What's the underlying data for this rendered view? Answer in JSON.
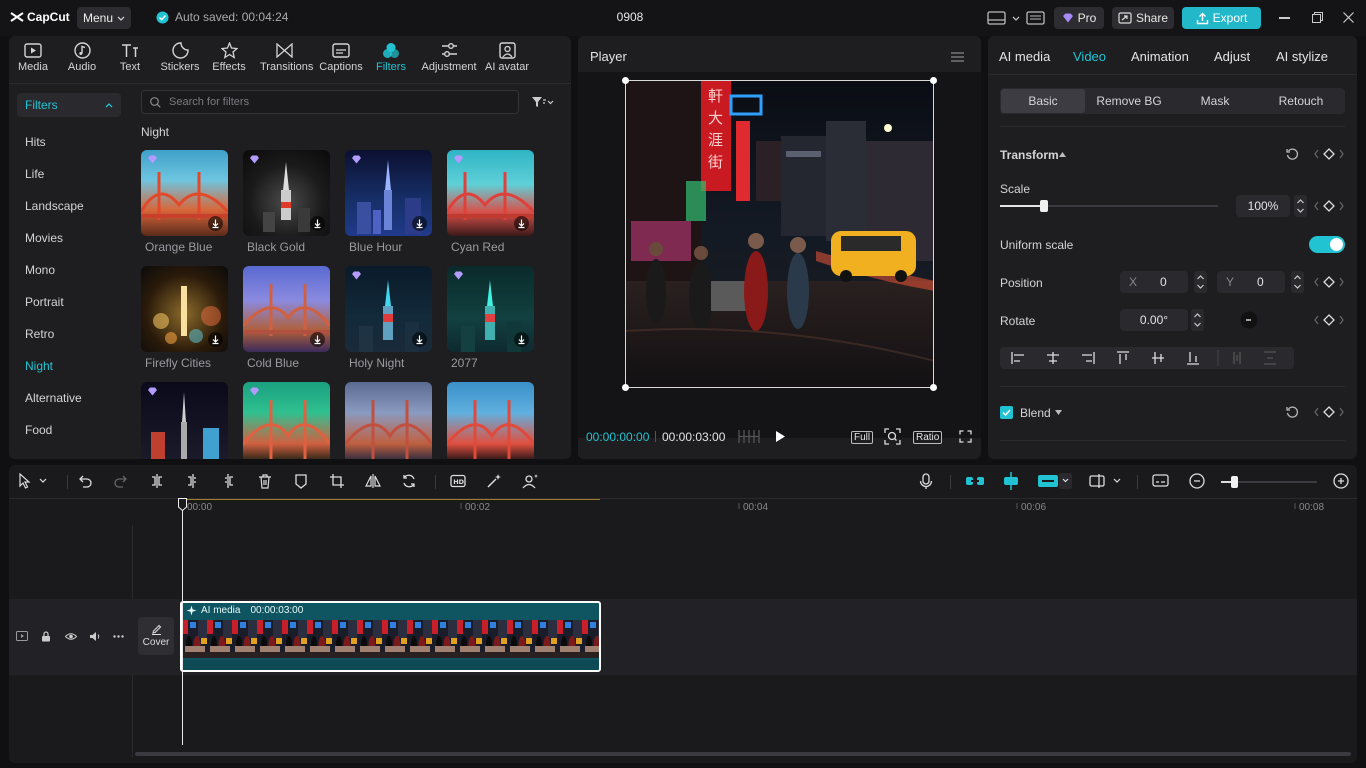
{
  "app": {
    "name": "CapCut",
    "menu_label": "Menu",
    "autosave": "Auto saved: 00:04:24",
    "project_title": "0908",
    "pro_label": "Pro",
    "share_label": "Share",
    "export_label": "Export"
  },
  "toolbar": {
    "items": [
      {
        "label": "Media",
        "icon": "media-icon"
      },
      {
        "label": "Audio",
        "icon": "audio-icon"
      },
      {
        "label": "Text",
        "icon": "text-icon"
      },
      {
        "label": "Stickers",
        "icon": "stickers-icon"
      },
      {
        "label": "Effects",
        "icon": "effects-icon"
      },
      {
        "label": "Transitions",
        "icon": "transitions-icon"
      },
      {
        "label": "Captions",
        "icon": "captions-icon"
      },
      {
        "label": "Filters",
        "icon": "filters-icon"
      },
      {
        "label": "Adjustment",
        "icon": "adjustment-icon"
      },
      {
        "label": "AI avatar",
        "icon": "ai-avatar-icon"
      }
    ],
    "active": "Filters"
  },
  "filters": {
    "header": "Filters",
    "search_placeholder": "Search for filters",
    "section_title": "Night",
    "categories": [
      "Hits",
      "Life",
      "Landscape",
      "Movies",
      "Mono",
      "Portrait",
      "Retro",
      "Night",
      "Alternative",
      "Food"
    ],
    "active_category": "Night",
    "items": [
      "Orange Blue",
      "Black Gold",
      "Blue Hour",
      "Cyan Red",
      "Firefly Cities",
      "Cold Blue",
      "Holy Night",
      "2077",
      "",
      "",
      "",
      ""
    ]
  },
  "player": {
    "title": "Player",
    "current_time": "00:00:00:00",
    "duration": "00:00:03:00",
    "full_label": "Full",
    "ratio_label": "Ratio"
  },
  "inspector": {
    "tabs": [
      "AI media",
      "Video",
      "Animation",
      "Adjust",
      "AI stylize"
    ],
    "active_tab": "Video",
    "subtabs": [
      "Basic",
      "Remove BG",
      "Mask",
      "Retouch"
    ],
    "active_subtab": "Basic",
    "transform_label": "Transform",
    "scale_label": "Scale",
    "scale_value": "100%",
    "scale_fraction": 0.2,
    "uniform_scale_label": "Uniform scale",
    "uniform_scale_on": true,
    "position_label": "Position",
    "pos_x_label": "X",
    "pos_x": "0",
    "pos_y_label": "Y",
    "pos_y": "0",
    "rotate_label": "Rotate",
    "rotate_value": "0.00°",
    "blend_label": "Blend"
  },
  "timeline": {
    "ruler": [
      "00:00",
      "00:02",
      "00:04",
      "00:06",
      "00:08"
    ],
    "clip_label": "AI media",
    "clip_duration": "00:00:03:00",
    "cover_label": "Cover"
  },
  "colors": {
    "accent": "#21c3d2",
    "clip_bg": "#0f5561",
    "panel": "#1e1e21"
  }
}
